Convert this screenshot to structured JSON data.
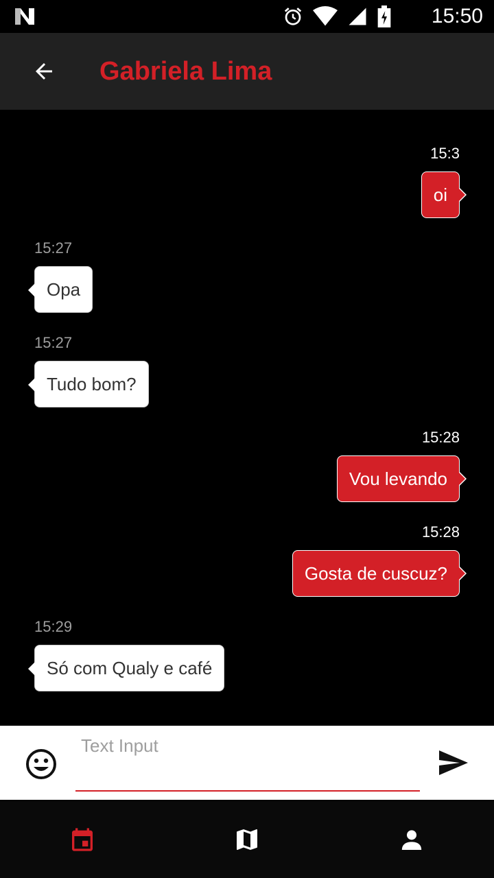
{
  "status_bar": {
    "clock": "15:50",
    "icons": [
      "n-logo-icon",
      "alarm-icon",
      "wifi-icon",
      "signal-icon",
      "battery-charging-icon"
    ]
  },
  "app_bar": {
    "back_icon": "arrow-back-icon",
    "title": "Gabriela Lima",
    "title_color": "#d32027",
    "background": "#212121"
  },
  "messages": [
    {
      "direction": "out",
      "time": "15:3",
      "text": "oi"
    },
    {
      "direction": "in",
      "time": "15:27",
      "text": "Opa"
    },
    {
      "direction": "in",
      "time": "15:27",
      "text": "Tudo bom?"
    },
    {
      "direction": "out",
      "time": "15:28",
      "text": "Vou levando"
    },
    {
      "direction": "out",
      "time": "15:28",
      "text": "Gosta de cuscuz?"
    },
    {
      "direction": "in",
      "time": "15:29",
      "text": "Só com Qualy e café"
    }
  ],
  "composer": {
    "emoji_icon": "emoji-icon",
    "placeholder": "Text Input",
    "value": "",
    "send_icon": "send-icon",
    "underline_color": "#d32027"
  },
  "bottom_nav": {
    "items": [
      {
        "icon": "calendar-icon",
        "active": true
      },
      {
        "icon": "map-icon",
        "active": false
      },
      {
        "icon": "person-icon",
        "active": false
      }
    ],
    "active_color": "#d32027",
    "inactive_color": "#ffffff"
  },
  "colors": {
    "accent": "#d32027",
    "outgoing_bubble": "#d32027",
    "incoming_bubble": "#ffffff",
    "chat_background": "#000000"
  }
}
